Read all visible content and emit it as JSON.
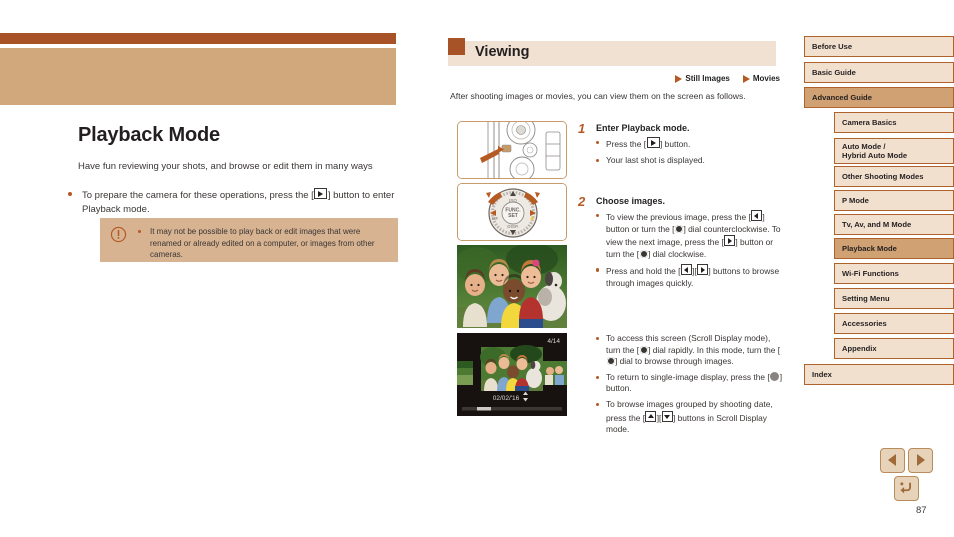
{
  "document": {
    "page_number": "87"
  },
  "left": {
    "chapter_title": "Playback Mode",
    "chapter_subtitle": "Have fun reviewing your shots, and browse or edit them in many ways",
    "lead_bullet_part1": "To prepare the camera for these operations, press the [",
    "lead_bullet_part2": "] button to enter Playback mode.",
    "caution": {
      "icon": "exclamation-circle-icon",
      "text": "It may not be possible to play back or edit images that were renamed or already edited on a computer, or images from other cameras."
    }
  },
  "middle": {
    "section_title": "Viewing",
    "tags": [
      {
        "label": "Still Images",
        "icon": "triangle-right-icon"
      },
      {
        "label": "Movies",
        "icon": "triangle-right-icon"
      }
    ],
    "intro": "After shooting images or movies, you can view them on the screen as follows.",
    "figures": [
      {
        "name": "camera-playback-button-illustration"
      },
      {
        "name": "camera-control-dial-illustration"
      },
      {
        "name": "single-image-display-photo"
      },
      {
        "name": "scroll-display-screen",
        "counter": "4/14",
        "date": "02/02/'16"
      }
    ],
    "steps": [
      {
        "number": "1",
        "title": "Enter Playback mode.",
        "bullets": [
          {
            "pre": "Press the [",
            "key": "playback-button",
            "post": "] button."
          },
          {
            "pre": "Your last shot is displayed.",
            "key": "",
            "post": ""
          }
        ]
      },
      {
        "number": "2",
        "title": "Choose images.",
        "bullets": [
          {
            "seg": [
              "To view the previous image, press the [",
              "LEFT",
              "] button or turn the [",
              "DIAL",
              "] dial counterclockwise. To view the next image, press the [",
              "RIGHT",
              "] button or turn the [",
              "DIAL",
              "] dial clockwise."
            ]
          },
          {
            "seg": [
              "Press and hold the [",
              "LEFT",
              "][",
              "RIGHT",
              "] buttons to browse through images quickly."
            ]
          }
        ]
      },
      {
        "number": "",
        "title": "",
        "bullets": [
          {
            "seg": [
              "To access this screen (Scroll Display mode), turn the [",
              "DIAL",
              "] dial rapidly. In this mode, turn the [",
              "DIAL",
              "] dial to browse through images."
            ]
          },
          {
            "seg": [
              "To return to single-image display, press the [",
              "FUNC",
              "] button."
            ]
          },
          {
            "seg": [
              "To browse images grouped by shooting date, press the [",
              "UP",
              "][",
              "DOWN",
              "] buttons in Scroll Display mode."
            ]
          }
        ]
      }
    ]
  },
  "nav": {
    "items": [
      {
        "label": "Before Use",
        "level": 1,
        "active": false
      },
      {
        "label": "Basic Guide",
        "level": 1,
        "active": false
      },
      {
        "label": "Advanced Guide",
        "level": 1,
        "active": true
      },
      {
        "label": "Camera Basics",
        "level": 2,
        "active": false
      },
      {
        "label": "Auto Mode /\nHybrid Auto Mode",
        "level": 2,
        "active": false
      },
      {
        "label": "Other Shooting Modes",
        "level": 2,
        "active": false
      },
      {
        "label": "P Mode",
        "level": 2,
        "active": false
      },
      {
        "label": "Tv, Av, and M Mode",
        "level": 2,
        "active": false
      },
      {
        "label": "Playback Mode",
        "level": 2,
        "active": true
      },
      {
        "label": "Wi-Fi Functions",
        "level": 2,
        "active": false
      },
      {
        "label": "Setting Menu",
        "level": 2,
        "active": false
      },
      {
        "label": "Accessories",
        "level": 2,
        "active": false
      },
      {
        "label": "Appendix",
        "level": 2,
        "active": false
      },
      {
        "label": "Index",
        "level": 1,
        "active": false
      }
    ]
  },
  "controls": {
    "prev": "previous-page-button",
    "next": "next-page-button",
    "home": "return-button"
  },
  "colors": {
    "accent_dark": "#a75227",
    "accent_mid": "#b55a23",
    "band_light": "#d0a87c",
    "nav_bg": "#f2e0cf",
    "nav_active": "#cfa173",
    "section_head_bg": "#f0e1d2",
    "caution_bg": "#d7b392"
  }
}
